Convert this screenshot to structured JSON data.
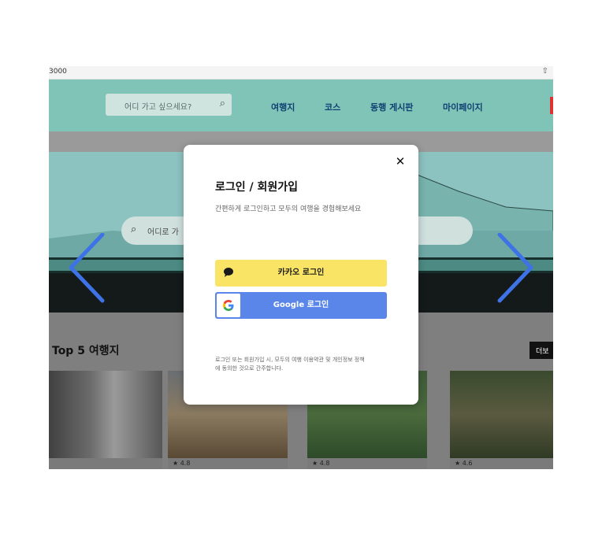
{
  "browser": {
    "url": "3000",
    "share_icon": "share-icon"
  },
  "nav": {
    "search_placeholder": "어디 가고 싶으세요?",
    "items": [
      "여행지",
      "코스",
      "동행 게시판",
      "마이페이지"
    ]
  },
  "hero": {
    "search_placeholder": "어디로 가"
  },
  "top5": {
    "title": "Top 5 여행지",
    "more": "더보",
    "ratings": [
      "",
      "4.8",
      "4.8",
      "4.6"
    ]
  },
  "modal": {
    "title": "로그인 / 회원가입",
    "subtitle": "간편하게 로그인하고 모두의 여행을 경험해보세요",
    "kakao_label": "카카오 로그인",
    "google_label": "Google 로그인",
    "terms_line1": "로그인 또는 회원가입 시, 모두의 여행 이용약관 및 개인정보 정책",
    "terms_line2": "에 동의한 것으로 간주합니다."
  },
  "colors": {
    "kakao": "#fae466",
    "google": "#5a86ea",
    "arrow": "#3e73e8",
    "nav": "#7fc4b6"
  }
}
